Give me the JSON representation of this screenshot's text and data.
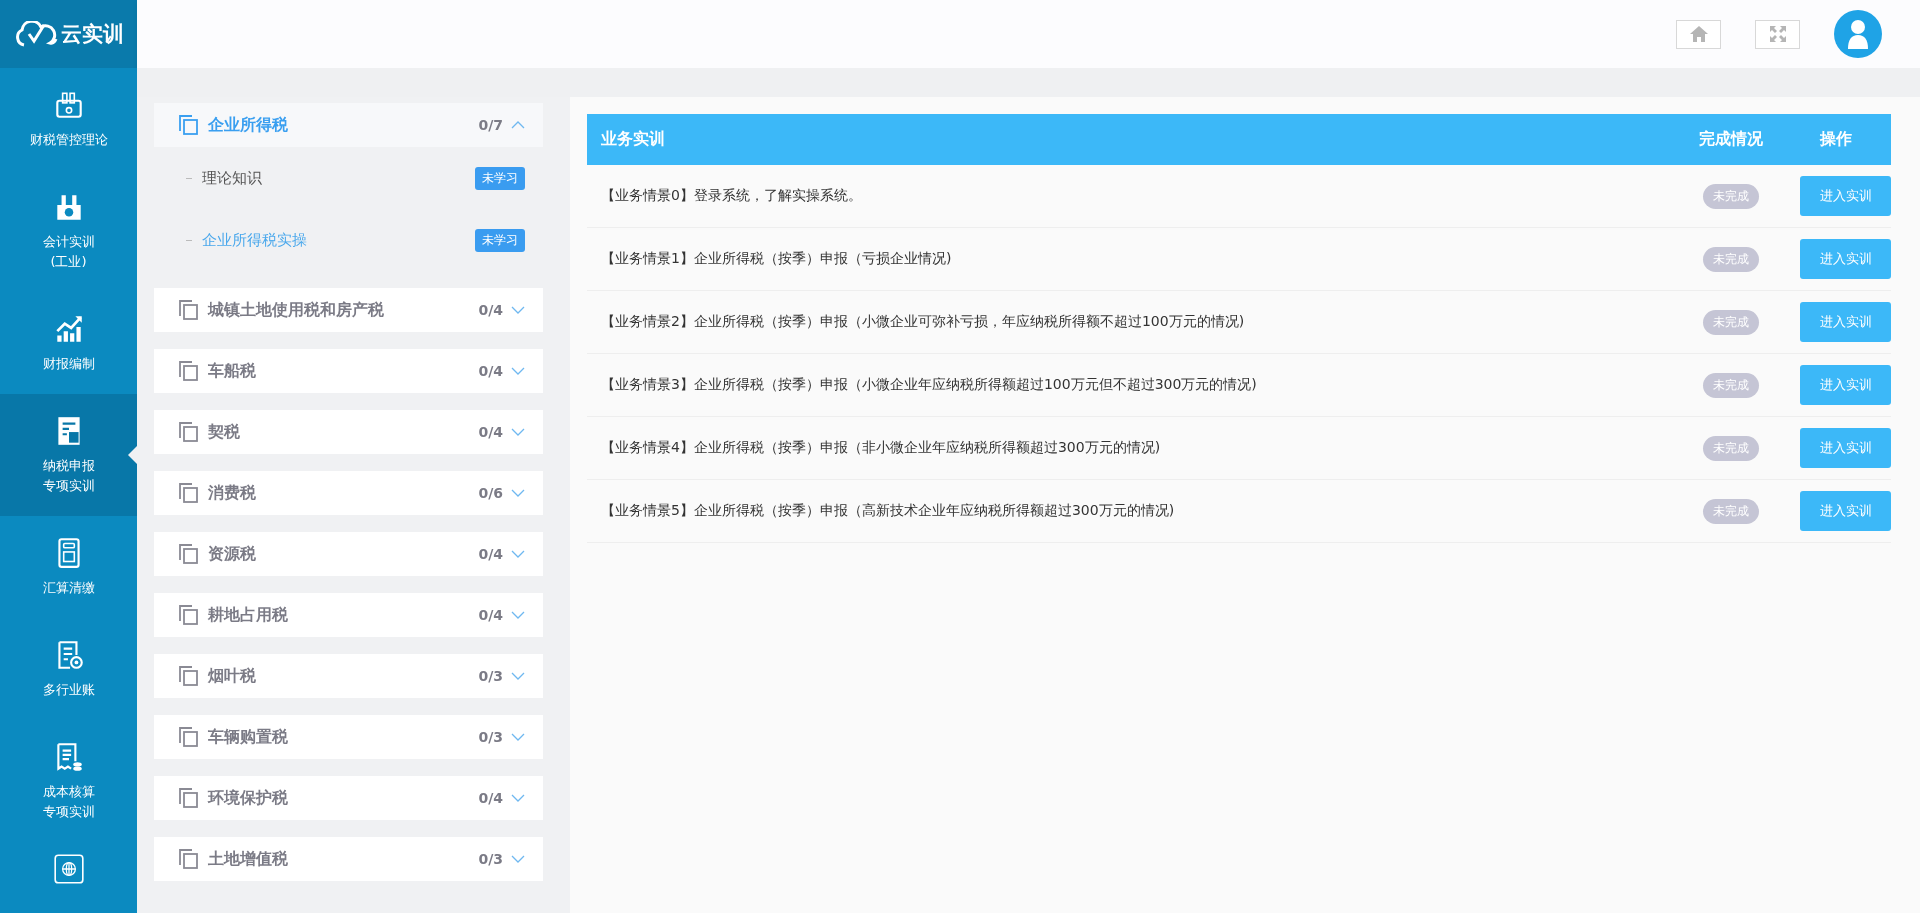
{
  "logo": {
    "text": "云实训"
  },
  "nav": [
    {
      "lines": [
        "财税管控理论"
      ],
      "selected": false
    },
    {
      "lines": [
        "会计实训",
        "(工业)"
      ],
      "selected": false
    },
    {
      "lines": [
        "财报编制"
      ],
      "selected": false
    },
    {
      "lines": [
        "纳税申报",
        "专项实训"
      ],
      "selected": true
    },
    {
      "lines": [
        "汇算清缴"
      ],
      "selected": false
    },
    {
      "lines": [
        "多行业账"
      ],
      "selected": false
    },
    {
      "lines": [
        "成本核算",
        "专项实训"
      ],
      "selected": false
    },
    {
      "selected": false
    }
  ],
  "categories": [
    {
      "title": "企业所得税",
      "progress": "0/7",
      "expanded": true,
      "children": [
        {
          "label": "理论知识",
          "badge": "未学习",
          "selected": false
        },
        {
          "label": "企业所得税实操",
          "badge": "未学习",
          "selected": true
        }
      ]
    },
    {
      "title": "城镇土地使用税和房产税",
      "progress": "0/4",
      "expanded": false
    },
    {
      "title": "车船税",
      "progress": "0/4",
      "expanded": false
    },
    {
      "title": "契税",
      "progress": "0/4",
      "expanded": false
    },
    {
      "title": "消费税",
      "progress": "0/6",
      "expanded": false
    },
    {
      "title": "资源税",
      "progress": "0/4",
      "expanded": false
    },
    {
      "title": "耕地占用税",
      "progress": "0/4",
      "expanded": false
    },
    {
      "title": "烟叶税",
      "progress": "0/3",
      "expanded": false
    },
    {
      "title": "车辆购置税",
      "progress": "0/3",
      "expanded": false
    },
    {
      "title": "环境保护税",
      "progress": "0/4",
      "expanded": false
    },
    {
      "title": "土地增值税",
      "progress": "0/3",
      "expanded": false
    }
  ],
  "table": {
    "columns": [
      "业务实训",
      "完成情况",
      "操作"
    ],
    "rows": [
      {
        "title": "【业务情景0】登录系统，了解实操系统。",
        "status": "未完成",
        "action": "进入实训"
      },
      {
        "title": "【业务情景1】企业所得税（按季）申报（亏损企业情况)",
        "status": "未完成",
        "action": "进入实训"
      },
      {
        "title": "【业务情景2】企业所得税（按季）申报（小微企业可弥补亏损，年应纳税所得额不超过100万元的情况)",
        "status": "未完成",
        "action": "进入实训"
      },
      {
        "title": "【业务情景3】企业所得税（按季）申报（小微企业年应纳税所得额超过100万元但不超过300万元的情况)",
        "status": "未完成",
        "action": "进入实训"
      },
      {
        "title": "【业务情景4】企业所得税（按季）申报（非小微企业年应纳税所得额超过300万元的情况)",
        "status": "未完成",
        "action": "进入实训"
      },
      {
        "title": "【业务情景5】企业所得税（按季）申报（高新技术企业年应纳税所得额超过300万元的情况)",
        "status": "未完成",
        "action": "进入实训"
      }
    ]
  }
}
